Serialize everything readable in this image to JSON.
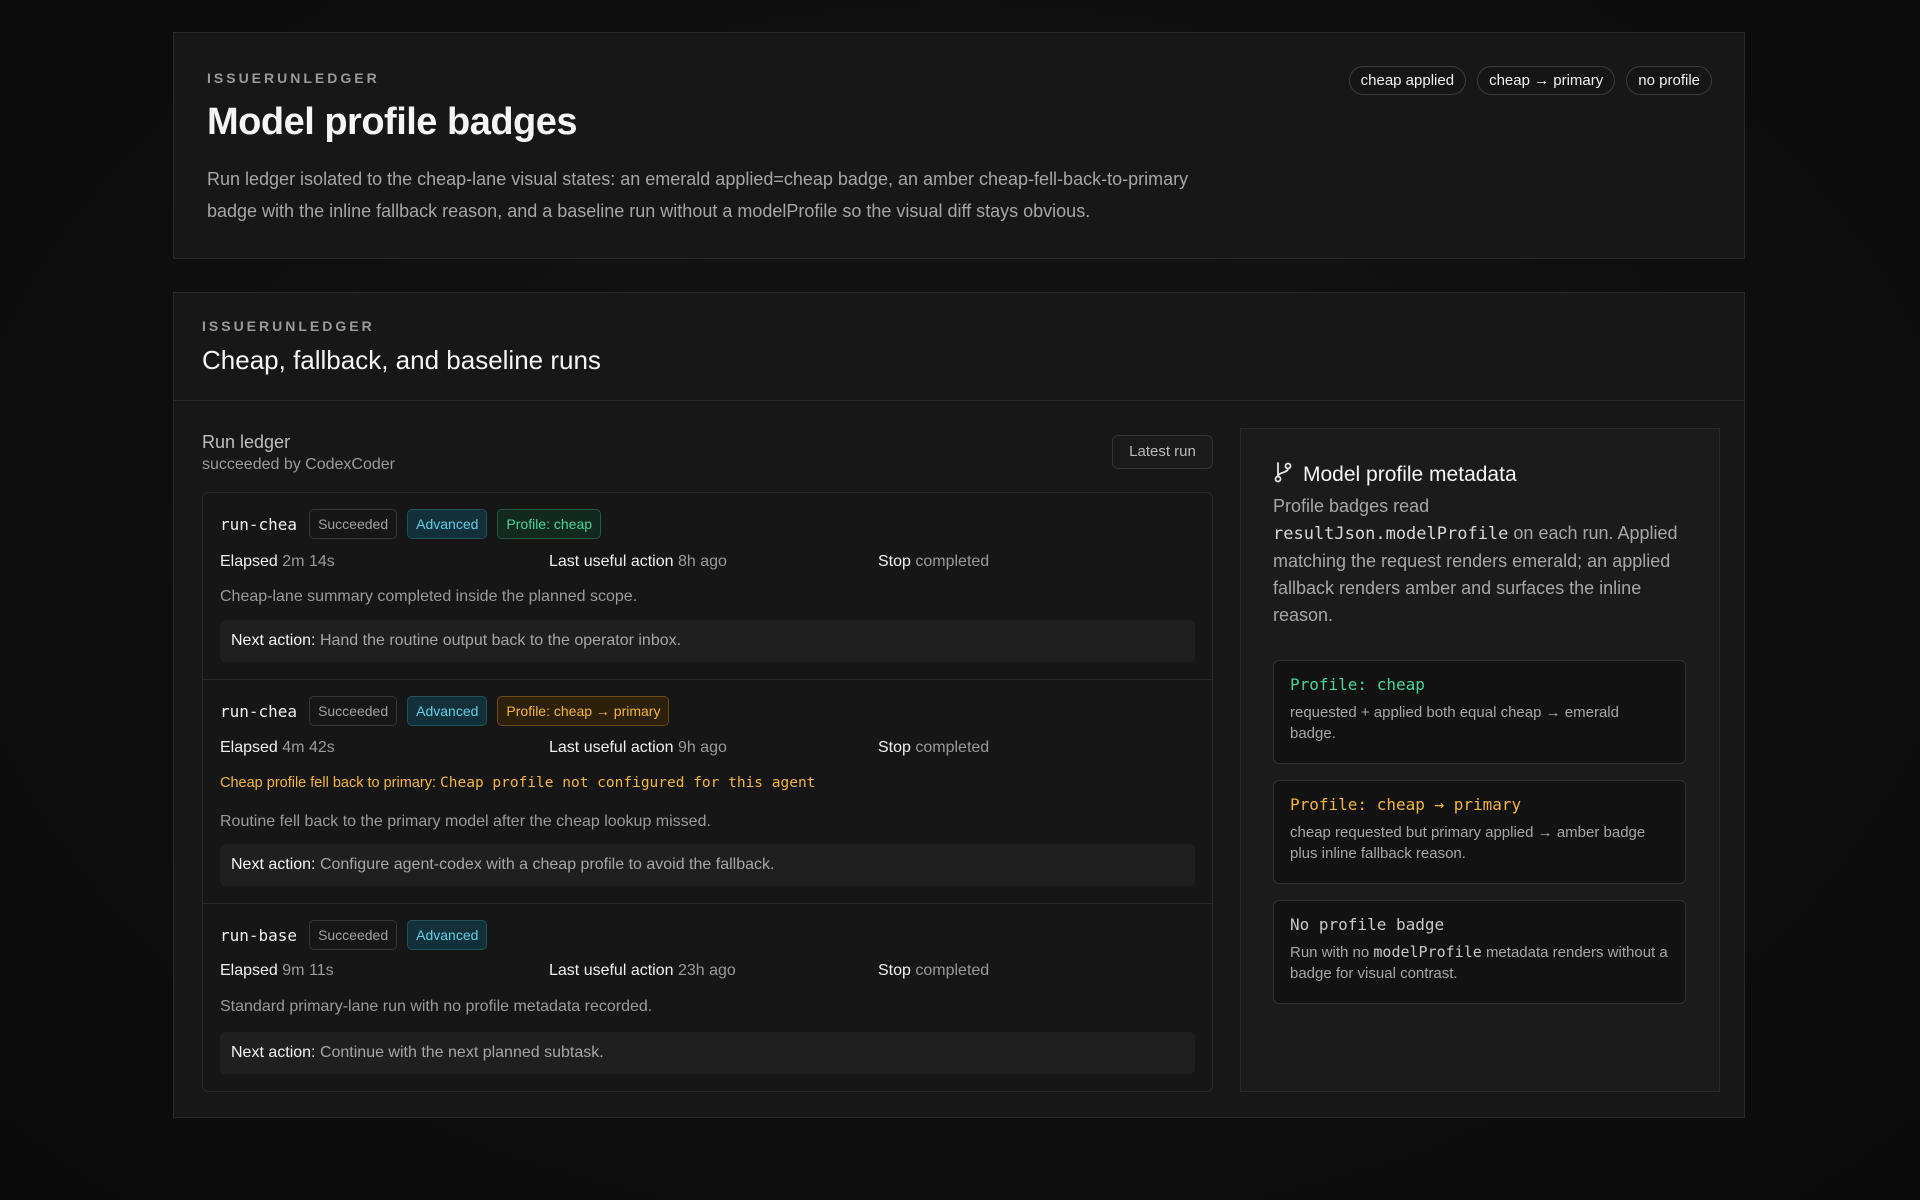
{
  "header": {
    "eyebrow": "ISSUERUNLEDGER",
    "title": "Model profile badges",
    "description": "Run ledger isolated to the cheap-lane visual states: an emerald applied=cheap badge, an amber cheap-fell-back-to-primary badge with the inline fallback reason, and a baseline run without a modelProfile so the visual diff stays obvious.",
    "pills": [
      "cheap applied",
      "cheap → primary",
      "no profile"
    ]
  },
  "section": {
    "eyebrow": "ISSUERUNLEDGER",
    "title": "Cheap, fallback, and baseline runs"
  },
  "ledger": {
    "title": "Run ledger",
    "subtitle": "succeeded by CodexCoder",
    "latest_button": "Latest run",
    "labels": {
      "elapsed": "Elapsed",
      "last_useful": "Last useful action",
      "stop": "Stop",
      "next_action": "Next action:"
    },
    "runs": [
      {
        "id": "run-chea",
        "status": "Succeeded",
        "mode": "Advanced",
        "profile": "Profile: cheap",
        "elapsed": "2m 14s",
        "last_useful": "8h ago",
        "stop": "completed",
        "summary": "Cheap-lane summary completed inside the planned scope.",
        "next_action": "Hand the routine output back to the operator inbox."
      },
      {
        "id": "run-chea",
        "status": "Succeeded",
        "mode": "Advanced",
        "profile": "Profile: cheap → primary",
        "elapsed": "4m 42s",
        "last_useful": "9h ago",
        "stop": "completed",
        "fallback_label": "Cheap profile fell back to primary:",
        "fallback_reason": "Cheap profile not configured for this agent",
        "summary": "Routine fell back to the primary model after the cheap lookup missed.",
        "next_action": "Configure agent-codex with a cheap profile to avoid the fallback."
      },
      {
        "id": "run-base",
        "status": "Succeeded",
        "mode": "Advanced",
        "elapsed": "9m 11s",
        "last_useful": "23h ago",
        "stop": "completed",
        "summary": "Standard primary-lane run with no profile metadata recorded.",
        "next_action": "Continue with the next planned subtask."
      }
    ]
  },
  "side": {
    "icon": "git-branch-icon",
    "title": "Model profile metadata",
    "desc_1": "Profile badges read",
    "desc_code": "resultJson.modelProfile",
    "desc_2": "on each run. Applied matching the request renders emerald; an applied fallback renders amber and surfaces the inline reason.",
    "legend": [
      {
        "title": "Profile: cheap",
        "desc": "requested + applied both equal cheap → emerald badge."
      },
      {
        "title": "Profile: cheap → primary",
        "desc": "cheap requested but primary applied → amber badge plus inline fallback reason."
      },
      {
        "title": "No profile badge",
        "desc_1": "Run with no",
        "desc_code": "modelProfile",
        "desc_2": "metadata renders without a badge for visual contrast."
      }
    ]
  },
  "colors": {
    "background": "#0d0d0d",
    "card": "#171717",
    "emerald": "#48d597",
    "amber": "#f3b53f",
    "cyan": "#5fd0e6"
  }
}
